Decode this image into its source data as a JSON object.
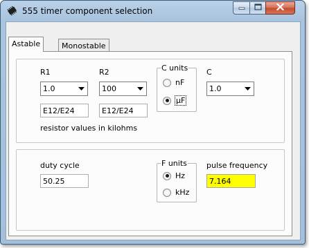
{
  "window": {
    "title": "555 timer component selection"
  },
  "tabs": [
    {
      "label": "Astable",
      "selected": true
    },
    {
      "label": "Monostable",
      "selected": false
    }
  ],
  "component_selection": {
    "r1": {
      "label": "R1",
      "value": "1.0",
      "series": "E12/E24"
    },
    "r2": {
      "label": "R2",
      "value": "100",
      "series": "E12/E24"
    },
    "c_units": {
      "legend": "C units",
      "options": [
        {
          "label": "nF",
          "selected": false
        },
        {
          "label": "µF",
          "selected": true
        }
      ]
    },
    "c": {
      "label": "C",
      "value": "1.0"
    },
    "note": "resistor values in kilohms"
  },
  "output": {
    "duty_cycle": {
      "label": "duty cycle",
      "value": "50.25"
    },
    "f_units": {
      "legend": "F units",
      "options": [
        {
          "label": "Hz",
          "selected": true
        },
        {
          "label": "kHz",
          "selected": false
        }
      ]
    },
    "pulse_frequency": {
      "label": "pulse frequency",
      "value": "7.164"
    }
  },
  "icons": {
    "app": "ic-chip-icon",
    "minimize": "minimize-icon",
    "maximize": "maximize-icon",
    "close": "close-icon",
    "dropdown": "chevron-down-icon"
  },
  "colors": {
    "frequency_highlight": "#ffff00",
    "close_button": "#c24b2c"
  }
}
